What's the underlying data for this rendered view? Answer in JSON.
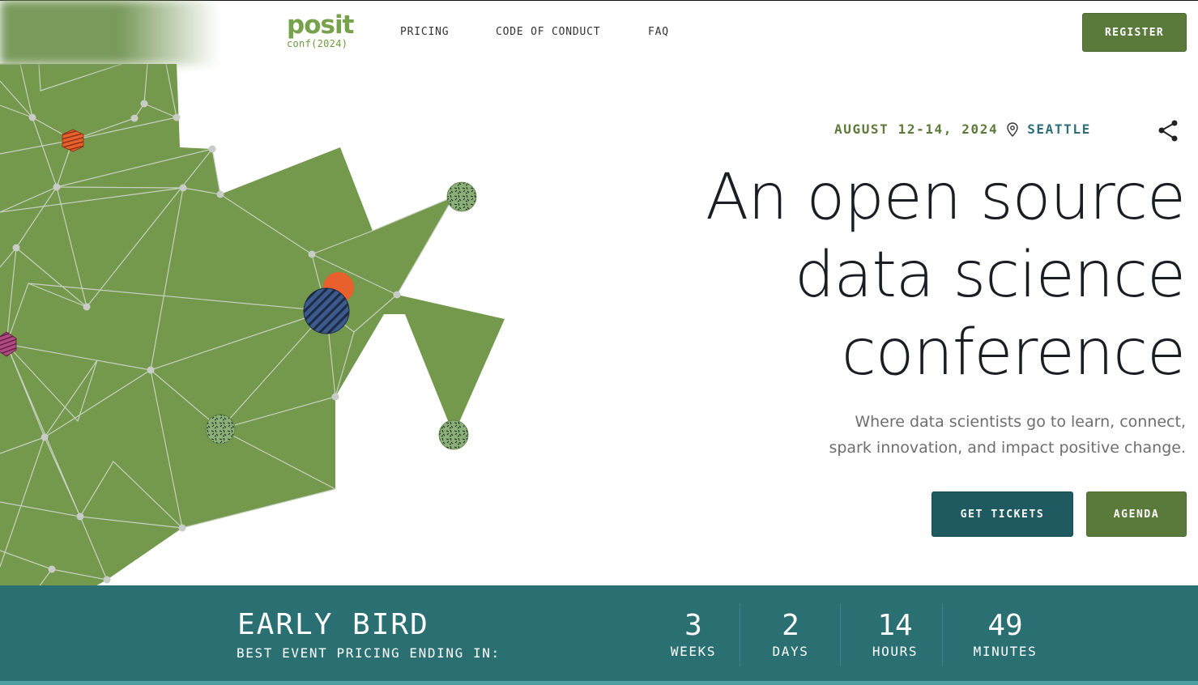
{
  "header": {
    "logo_word": "posit",
    "logo_sub": "conf(2024)",
    "nav": [
      {
        "label": "PRICING"
      },
      {
        "label": "CODE OF CONDUCT"
      },
      {
        "label": "FAQ"
      }
    ],
    "register_label": "REGISTER"
  },
  "hero": {
    "date": "AUGUST 12-14, 2024",
    "city": "SEATTLE",
    "headline": [
      "An open source",
      "data science",
      "conference"
    ],
    "subhead": [
      "Where data scientists go to learn, connect,",
      "spark innovation, and impact positive change."
    ],
    "cta_primary": "GET TICKETS",
    "cta_secondary": "AGENDA"
  },
  "countdown": {
    "title": "EARLY BIRD",
    "subtitle": "BEST EVENT PRICING ENDING IN:",
    "units": [
      {
        "value": "3",
        "label": "WEEKS"
      },
      {
        "value": "2",
        "label": "DAYS"
      },
      {
        "value": "14",
        "label": "HOURS"
      },
      {
        "value": "49",
        "label": "MINUTES"
      }
    ]
  },
  "icons": {
    "location": "map-pin-icon",
    "share": "share-icon"
  },
  "colors": {
    "brand_green": "#5a7a3c",
    "art_green": "#74984c",
    "teal_dark": "#1f5a60",
    "band_teal": "#2a7073",
    "accent_orange": "#e8602c",
    "accent_blue": "#3a5b8c",
    "accent_magenta": "#a8417a"
  }
}
